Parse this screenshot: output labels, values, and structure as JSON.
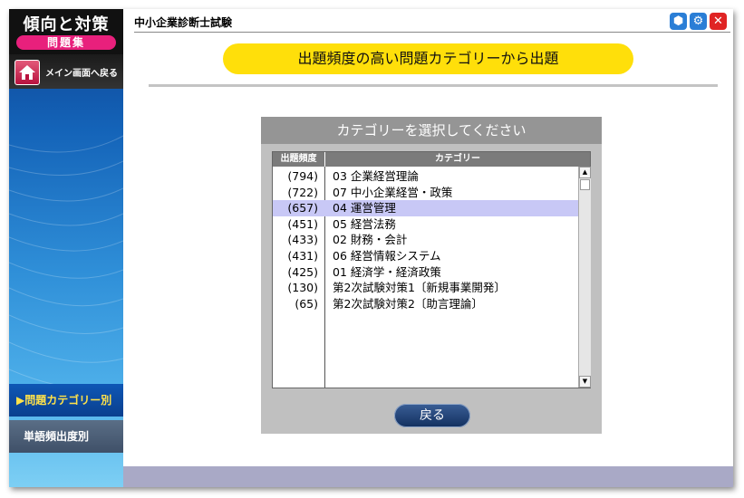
{
  "sidebar": {
    "logo_title": "傾向と対策",
    "logo_badge": "問題集",
    "home_label": "メイン画面へ戻る",
    "nav": [
      {
        "label": "▶問題カテゴリー別",
        "active": true
      },
      {
        "label": "単語頻出度別",
        "active": false
      }
    ]
  },
  "header": {
    "app_title": "中小企業診断士試験",
    "window_buttons": [
      "minimize-icon",
      "gear-icon",
      "close-icon"
    ],
    "window_glyphs": [
      "⬢",
      "⚙",
      "✕"
    ]
  },
  "banner": {
    "text": "出題頻度の高い問題カテゴリーから出題"
  },
  "dialog": {
    "title": "カテゴリーを選択してください",
    "columns": [
      "出題頻度",
      "カテゴリー"
    ],
    "rows": [
      {
        "freq": "(794)",
        "category": "03 企業経営理論"
      },
      {
        "freq": "(722)",
        "category": "07 中小企業経営・政策"
      },
      {
        "freq": "(657)",
        "category": "04 運営管理",
        "selected": true
      },
      {
        "freq": "(451)",
        "category": "05 経営法務"
      },
      {
        "freq": "(433)",
        "category": "02 財務・会計"
      },
      {
        "freq": "(431)",
        "category": "06 経営情報システム"
      },
      {
        "freq": "(425)",
        "category": "01 経済学・経済政策"
      },
      {
        "freq": "(130)",
        "category": "第2次試験対策1〔新規事業開発〕"
      },
      {
        "freq": "(65)",
        "category": "第2次試験対策2〔助言理論〕"
      }
    ],
    "back_label": "戻る"
  },
  "colors": {
    "banner": "#ffdf0a",
    "selected_row": "#c8c8f6",
    "badge": "#e8207c",
    "close_button": "#e02424",
    "active_nav_text": "#ffe24a"
  }
}
